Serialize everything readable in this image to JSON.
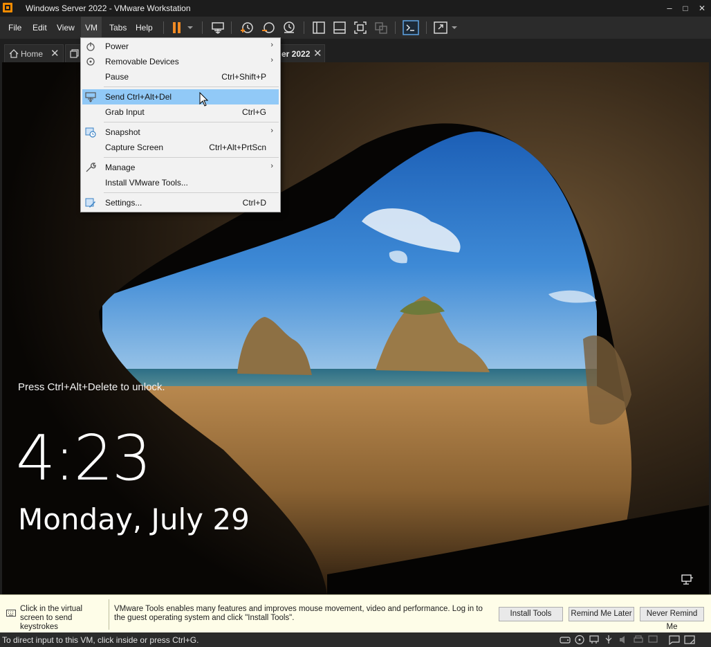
{
  "window": {
    "title": "Windows Server 2022 - VMware Workstation",
    "controls": {
      "minimize": "–",
      "maximize": "□",
      "close": "✕"
    }
  },
  "menubar": {
    "items": [
      {
        "label": "File"
      },
      {
        "label": "Edit"
      },
      {
        "label": "View"
      },
      {
        "label": "VM",
        "active": true
      },
      {
        "label": "Tabs"
      },
      {
        "label": "Help"
      }
    ]
  },
  "tabs": {
    "home_label": "Home",
    "vm_tab_label_visible": "er 2022",
    "close_glyph": "✕"
  },
  "vm_menu": {
    "items": [
      {
        "label": "Power",
        "shortcut": "",
        "submenu": true,
        "icon": "power-icon"
      },
      {
        "label": "Removable Devices",
        "shortcut": "",
        "submenu": true,
        "icon": "removable-devices-icon"
      },
      {
        "label": "Pause",
        "shortcut": "Ctrl+Shift+P",
        "submenu": false,
        "icon": ""
      },
      {
        "label": "Send Ctrl+Alt+Del",
        "shortcut": "",
        "submenu": false,
        "icon": "send-ctrl-alt-del-icon",
        "highlighted": true
      },
      {
        "label": "Grab Input",
        "shortcut": "Ctrl+G",
        "submenu": false,
        "icon": ""
      },
      {
        "label": "Snapshot",
        "shortcut": "",
        "submenu": true,
        "icon": "snapshot-icon"
      },
      {
        "label": "Capture Screen",
        "shortcut": "Ctrl+Alt+PrtScn",
        "submenu": false,
        "icon": ""
      },
      {
        "label": "Manage",
        "shortcut": "",
        "submenu": true,
        "icon": "wrench-icon"
      },
      {
        "label": "Install VMware Tools...",
        "shortcut": "",
        "submenu": false,
        "icon": ""
      },
      {
        "label": "Settings...",
        "shortcut": "Ctrl+D",
        "submenu": false,
        "icon": "settings-icon"
      }
    ],
    "submenu_glyph": "›"
  },
  "guest": {
    "lock_hint": "Press Ctrl+Alt+Delete to unlock.",
    "time": "4:23",
    "date": "Monday, July 29"
  },
  "notification": {
    "left_text": "Click in the virtual screen to send keystrokes",
    "message": "VMware Tools enables many features and improves mouse movement, video and performance. Log in to the guest operating system and click \"Install Tools\".",
    "buttons": {
      "install": "Install Tools",
      "remind_later": "Remind Me Later",
      "never_remind": "Never Remind Me"
    }
  },
  "statusbar": {
    "text": "To direct input to this VM, click inside or press Ctrl+G."
  },
  "colors": {
    "accent_pause": "#f08a24",
    "menu_highlight": "#91c9f7",
    "notification_bg": "#fefde8"
  }
}
